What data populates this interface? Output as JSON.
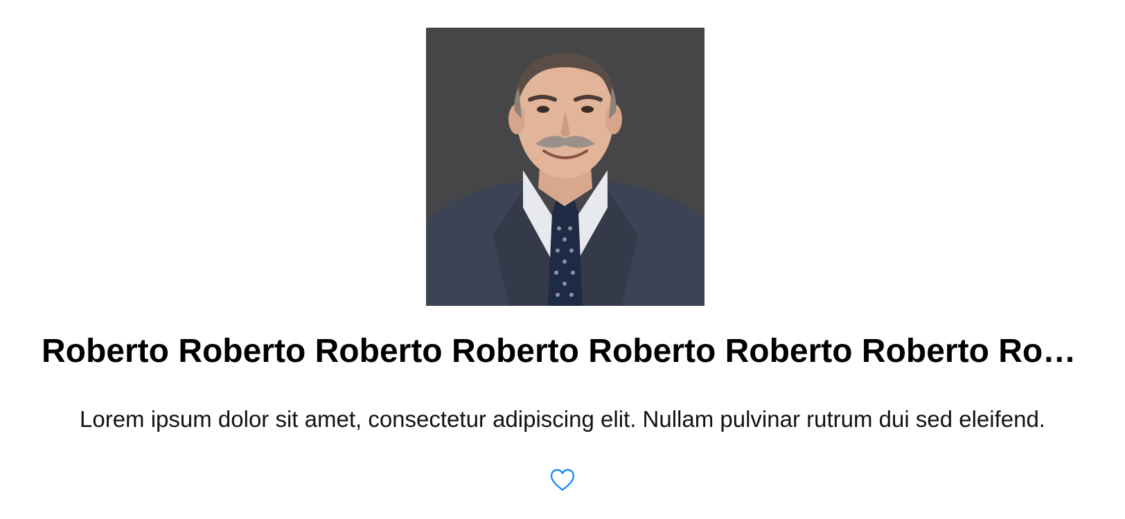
{
  "profile": {
    "name": "Roberto Roberto Roberto Roberto Roberto Roberto Roberto Roberto Roberto Roberto",
    "description": "Lorem ipsum dolor sit amet, consectetur adipiscing elit. Nullam pulvinar rutrum dui sed eleifend.",
    "photo_icon": "person-portrait",
    "favorite_icon": "heart-outline-icon"
  },
  "colors": {
    "accent": "#1a8cff",
    "background": "#ffffff",
    "title": "#000000",
    "text": "#111111"
  }
}
